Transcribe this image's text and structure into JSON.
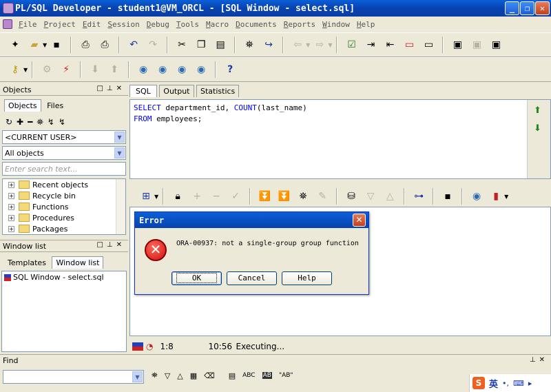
{
  "window": {
    "title": "PL/SQL Developer - student1@VM_ORCL - [SQL Window - select.sql]",
    "min": "_",
    "max": "❐",
    "close": "✕"
  },
  "menu": [
    {
      "u": "F",
      "rest": "ile"
    },
    {
      "u": "P",
      "rest": "roject"
    },
    {
      "u": "E",
      "rest": "dit"
    },
    {
      "u": "S",
      "rest": "ession"
    },
    {
      "u": "D",
      "rest": "ebug"
    },
    {
      "u": "T",
      "rest": "ools"
    },
    {
      "u": "M",
      "rest": "acro"
    },
    {
      "u": "D",
      "rest": "ocuments"
    },
    {
      "u": "R",
      "rest": "eports"
    },
    {
      "u": "W",
      "rest": "indow"
    },
    {
      "u": "H",
      "rest": "elp"
    }
  ],
  "objects_panel": {
    "header": "Objects",
    "tabs": [
      "Objects",
      "Files"
    ],
    "user_combo": "<CURRENT USER>",
    "filter_combo": "All objects",
    "search_placeholder": "Enter search text...",
    "tree": [
      "Recent objects",
      "Recycle bin",
      "Functions",
      "Procedures",
      "Packages"
    ]
  },
  "windowlist_panel": {
    "header": "Window list",
    "tabs": [
      "Templates",
      "Window list"
    ],
    "item": "SQL Window - select.sql"
  },
  "editor_tabs": [
    "SQL",
    "Output",
    "Statistics"
  ],
  "sql": {
    "line1": {
      "kw1": "SELECT",
      "t1": " department_id, ",
      "kw2": "COUNT",
      "t2": "(last_name)"
    },
    "line2": {
      "kw1": "FROM",
      "t1": " employees;"
    }
  },
  "error_dialog": {
    "title": "Error",
    "message": "ORA-00937: not a single-group group function",
    "ok": "OK",
    "cancel": "Cancel",
    "help": "Help"
  },
  "status": {
    "position": "1:8",
    "time": "10:56",
    "message": "Executing..."
  },
  "find_panel": {
    "label": "Find",
    "tools": [
      "ABC",
      "AB",
      "\"AB\""
    ]
  },
  "ime": {
    "label": "英"
  }
}
